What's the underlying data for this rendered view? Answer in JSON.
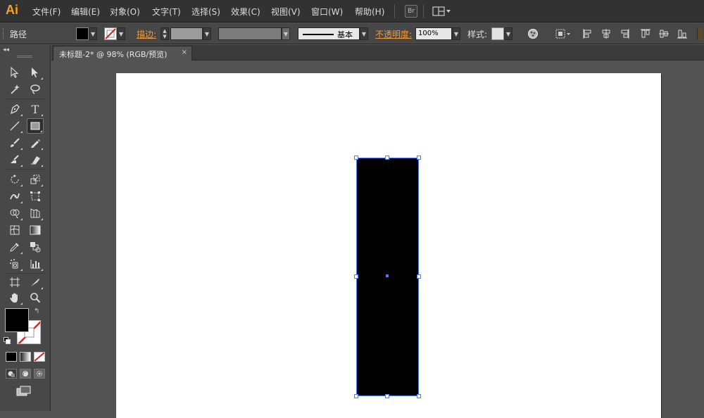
{
  "app": {
    "logo": "Ai"
  },
  "menu": {
    "items": [
      "文件(F)",
      "编辑(E)",
      "对象(O)",
      "文字(T)",
      "选择(S)",
      "效果(C)",
      "视图(V)",
      "窗口(W)",
      "帮助(H)"
    ],
    "bridge_icon": "Br",
    "workspace_icon": "arrange-documents-icon"
  },
  "control": {
    "selection_type": "路径",
    "stroke_label": "描边:",
    "stroke_profile": "基本",
    "opacity_label": "不透明度:",
    "opacity_value": "100%",
    "style_label": "样式:"
  },
  "document": {
    "tab_title": "未标题-2* @ 98% (RGB/预览)",
    "close_glyph": "×"
  },
  "tools": {
    "active": "rectangle-tool",
    "list": [
      "selection-tool",
      "direct-selection-tool",
      "magic-wand-tool",
      "lasso-tool",
      "pen-tool",
      "type-tool",
      "line-segment-tool",
      "rectangle-tool",
      "paintbrush-tool",
      "pencil-tool",
      "blob-brush-tool",
      "eraser-tool",
      "rotate-tool",
      "scale-tool",
      "width-tool",
      "free-transform-tool",
      "shape-builder-tool",
      "perspective-grid-tool",
      "mesh-tool",
      "gradient-tool",
      "eyedropper-tool",
      "blend-tool",
      "symbol-sprayer-tool",
      "column-graph-tool",
      "artboard-tool",
      "slice-tool",
      "hand-tool",
      "zoom-tool"
    ]
  },
  "colors": {
    "accent_orange": "#f09a3a",
    "logo_orange": "#f7a21b",
    "fill": "#000000",
    "selection": "#4d7ef0",
    "artboard": "#ffffff",
    "ui_dark": "#323232",
    "ui_mid": "#474747"
  }
}
